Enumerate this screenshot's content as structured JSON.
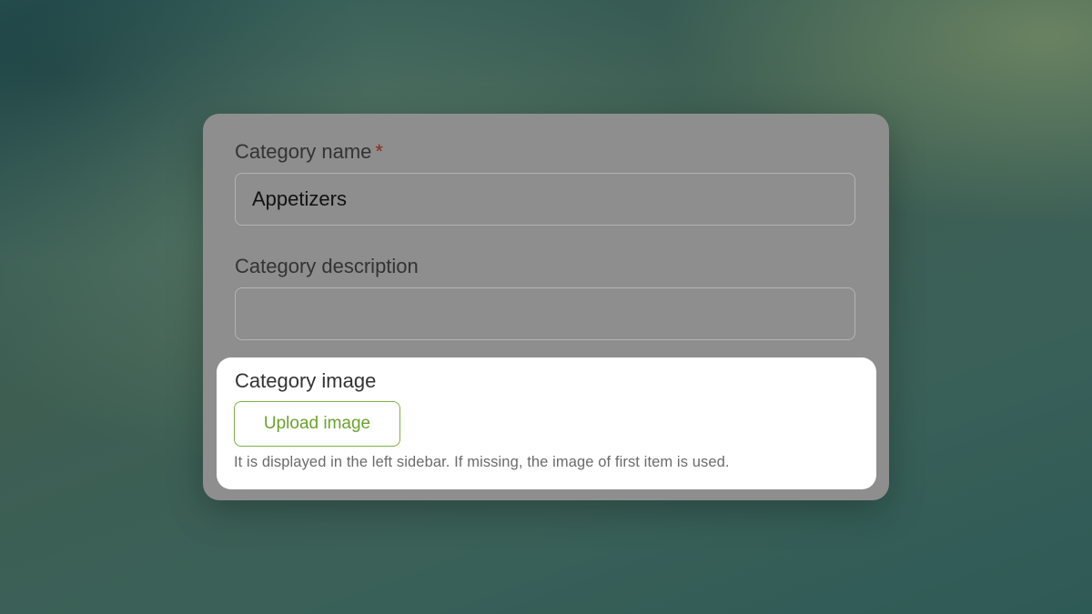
{
  "form": {
    "category_name": {
      "label": "Category name",
      "required_mark": "*",
      "value": "Appetizers"
    },
    "category_description": {
      "label": "Category description",
      "value": ""
    },
    "category_image": {
      "label": "Category image",
      "button_label": "Upload image",
      "hint": "It is displayed in the left sidebar. If missing, the image of first item is used."
    }
  },
  "colors": {
    "accent_green": "#6aa22e",
    "required_red": "#8a2a1e"
  }
}
